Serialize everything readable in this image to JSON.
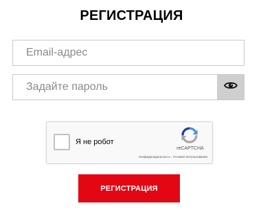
{
  "form": {
    "title": "РЕГИСТРАЦИЯ",
    "email_placeholder": "Email-адрес",
    "email_value": "",
    "password_placeholder": "Задайте пароль",
    "password_value": "",
    "password_toggle_icon": "eye-icon",
    "submit_label": "РЕГИСТРАЦИЯ"
  },
  "captcha": {
    "label": "Я не робот",
    "checked": false,
    "brand": "reCAPTCHA",
    "privacy_link": "Конфиденциальность",
    "separator": " - ",
    "terms_link": "Условия использования",
    "logo_icon": "recaptcha-logo-icon"
  },
  "colors": {
    "submit_background": "#e30613",
    "submit_text": "#ffffff",
    "toggle_background": "#cfcfcf",
    "field_border": "#c9c9c9"
  }
}
